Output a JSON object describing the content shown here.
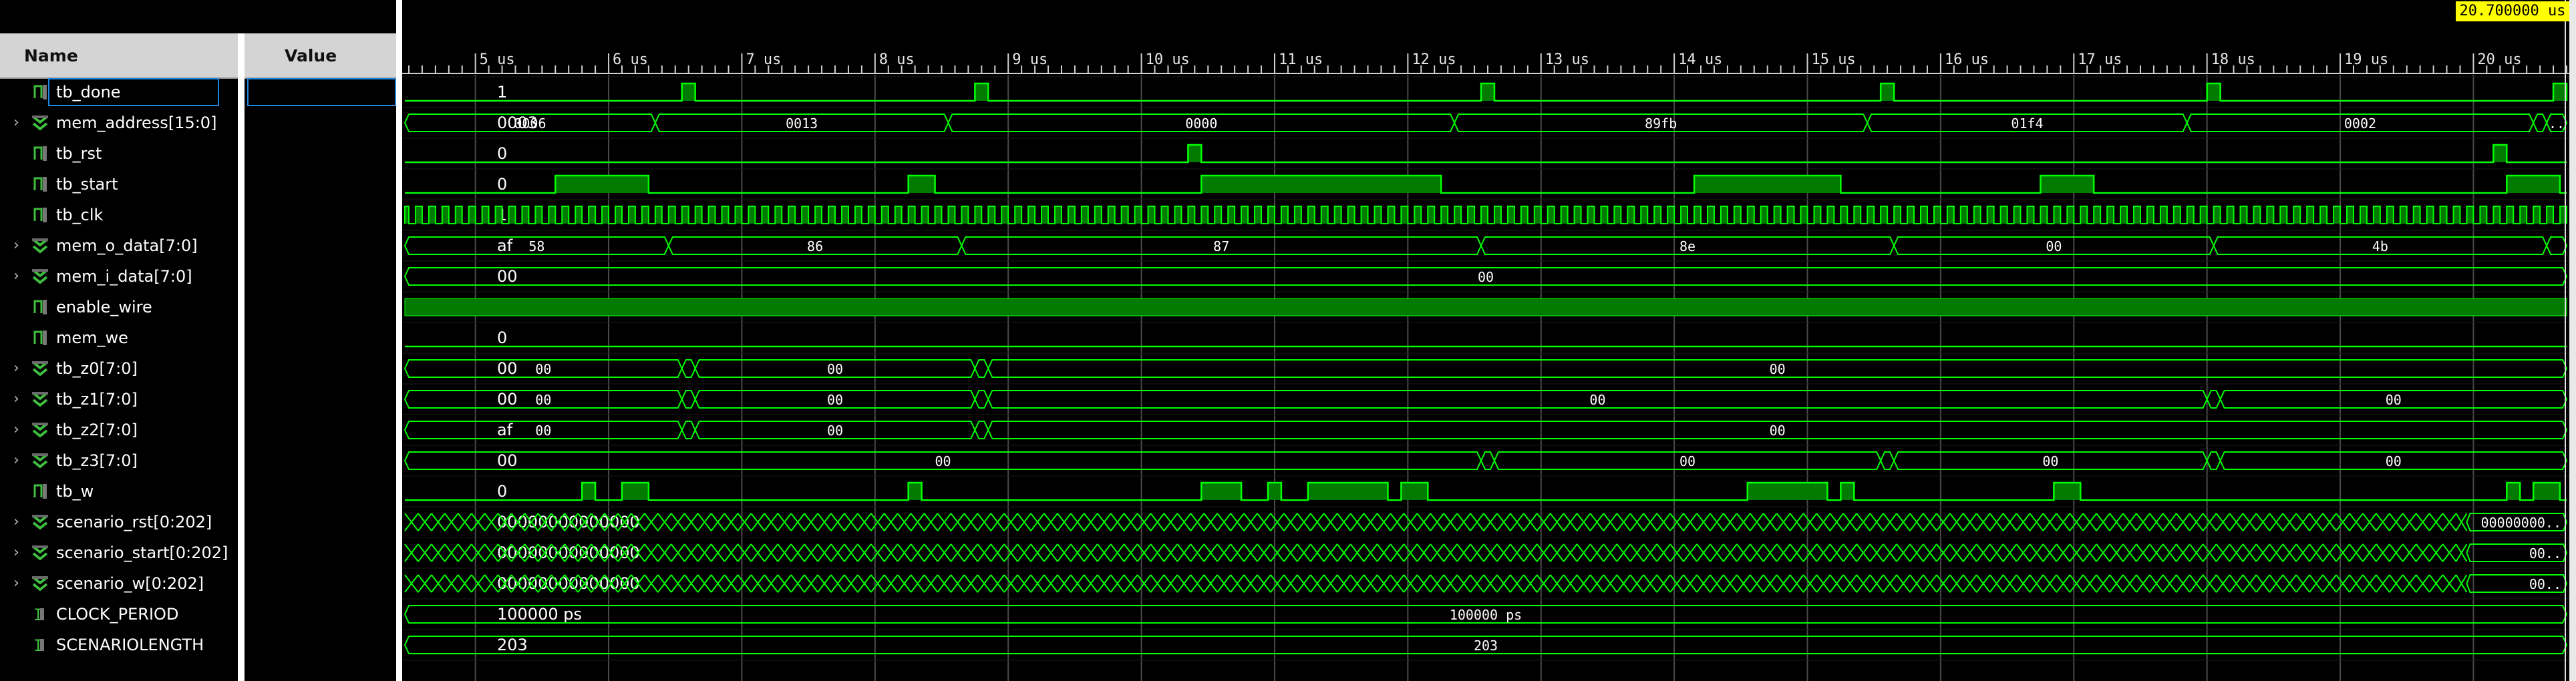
{
  "columns": {
    "name": "Name",
    "value": "Value"
  },
  "cursor": {
    "time": "20.700000 us"
  },
  "colors": {
    "wave": "#00ff00",
    "fill": "#007a00",
    "grid": "#4a4a4a",
    "cursor": "#ffff00"
  },
  "signals": [
    {
      "name": "tb_done",
      "value": "1",
      "kind": "bit",
      "expandable": false
    },
    {
      "name": "mem_address[15:0]",
      "value": "0003",
      "kind": "bus",
      "expandable": true
    },
    {
      "name": "tb_rst",
      "value": "0",
      "kind": "bit",
      "expandable": false
    },
    {
      "name": "tb_start",
      "value": "0",
      "kind": "bit",
      "expandable": false
    },
    {
      "name": "tb_clk",
      "value": "1",
      "kind": "bit",
      "expandable": false
    },
    {
      "name": "mem_o_data[7:0]",
      "value": "af",
      "kind": "bus",
      "expandable": true
    },
    {
      "name": "mem_i_data[7:0]",
      "value": "00",
      "kind": "bus",
      "expandable": true
    },
    {
      "name": "enable_wire",
      "value": "1",
      "kind": "bit",
      "expandable": false
    },
    {
      "name": "mem_we",
      "value": "0",
      "kind": "bit",
      "expandable": false
    },
    {
      "name": "tb_z0[7:0]",
      "value": "00",
      "kind": "bus",
      "expandable": true
    },
    {
      "name": "tb_z1[7:0]",
      "value": "00",
      "kind": "bus",
      "expandable": true
    },
    {
      "name": "tb_z2[7:0]",
      "value": "af",
      "kind": "bus",
      "expandable": true
    },
    {
      "name": "tb_z3[7:0]",
      "value": "00",
      "kind": "bus",
      "expandable": true
    },
    {
      "name": "tb_w",
      "value": "0",
      "kind": "bit",
      "expandable": false
    },
    {
      "name": "scenario_rst[0:202]",
      "value": "0000000000000000",
      "kind": "bus",
      "expandable": true
    },
    {
      "name": "scenario_start[0:202]",
      "value": "0000000000000000",
      "kind": "bus",
      "expandable": true
    },
    {
      "name": "scenario_w[0:202]",
      "value": "0000000000000000",
      "kind": "bus",
      "expandable": true
    },
    {
      "name": "CLOCK_PERIOD",
      "value": "100000 ps",
      "kind": "param",
      "expandable": false
    },
    {
      "name": "SCENARIOLENGTH",
      "value": "203",
      "kind": "param",
      "expandable": false
    }
  ],
  "timeline": {
    "start_us": 4.47,
    "end_us": 20.7,
    "tick_labels": [
      "5 us",
      "6 us",
      "7 us",
      "8 us",
      "9 us",
      "10 us",
      "11 us",
      "12 us",
      "13 us",
      "14 us",
      "15 us",
      "16 us",
      "17 us",
      "18 us",
      "19 us",
      "20 us"
    ],
    "tick_values": [
      5,
      6,
      7,
      8,
      9,
      10,
      11,
      12,
      13,
      14,
      15,
      16,
      17,
      18,
      19,
      20
    ]
  },
  "waves": {
    "tb_done": {
      "type": "bit",
      "init": 0,
      "high": [
        [
          6.55,
          6.65
        ],
        [
          8.75,
          8.85
        ],
        [
          12.55,
          12.65
        ],
        [
          15.55,
          15.65
        ],
        [
          18.0,
          18.1
        ],
        [
          20.6,
          20.7
        ]
      ]
    },
    "mem_address": {
      "type": "bus",
      "segs": [
        [
          4.47,
          6.35,
          "0006"
        ],
        [
          6.35,
          8.55,
          "0013"
        ],
        [
          8.55,
          12.35,
          "0000"
        ],
        [
          12.35,
          15.45,
          "89fb"
        ],
        [
          15.45,
          17.85,
          "01f4"
        ],
        [
          17.85,
          20.45,
          "0002"
        ],
        [
          20.45,
          20.55,
          ""
        ],
        [
          20.55,
          20.7,
          ".."
        ]
      ]
    },
    "tb_rst": {
      "type": "bit",
      "init": 0,
      "high": [
        [
          10.35,
          10.45
        ],
        [
          20.15,
          20.25
        ]
      ]
    },
    "tb_start": {
      "type": "bit",
      "init": 0,
      "high": [
        [
          5.6,
          6.3
        ],
        [
          8.25,
          8.45
        ],
        [
          10.45,
          12.25
        ],
        [
          14.15,
          15.25
        ],
        [
          16.75,
          17.15
        ],
        [
          20.25,
          20.65
        ]
      ]
    },
    "tb_clk": {
      "type": "clock",
      "period": 0.1
    },
    "mem_o_data": {
      "type": "bus",
      "segs": [
        [
          4.47,
          6.45,
          "58"
        ],
        [
          6.45,
          8.65,
          "86"
        ],
        [
          8.65,
          12.55,
          "87"
        ],
        [
          12.55,
          15.65,
          "8e"
        ],
        [
          15.65,
          18.05,
          "00"
        ],
        [
          18.05,
          20.55,
          "4b"
        ],
        [
          20.55,
          20.7,
          ""
        ]
      ]
    },
    "mem_i_data": {
      "type": "bus",
      "segs": [
        [
          4.47,
          20.7,
          "00"
        ]
      ]
    },
    "enable_wire": {
      "type": "solid"
    },
    "mem_we": {
      "type": "bit",
      "init": 0,
      "high": []
    },
    "tb_z0": {
      "type": "bus",
      "segs": [
        [
          4.47,
          6.55,
          "00"
        ],
        [
          6.55,
          6.65,
          ""
        ],
        [
          6.65,
          8.75,
          "00"
        ],
        [
          8.75,
          8.85,
          ""
        ],
        [
          8.85,
          20.7,
          "00"
        ]
      ]
    },
    "tb_z1": {
      "type": "bus",
      "segs": [
        [
          4.47,
          6.55,
          "00"
        ],
        [
          6.55,
          6.65,
          ""
        ],
        [
          6.65,
          8.75,
          "00"
        ],
        [
          8.75,
          8.85,
          ""
        ],
        [
          8.85,
          18.0,
          "00"
        ],
        [
          18.0,
          18.1,
          ""
        ],
        [
          18.1,
          20.7,
          "00"
        ]
      ]
    },
    "tb_z2": {
      "type": "bus",
      "segs": [
        [
          4.47,
          6.55,
          "00"
        ],
        [
          6.55,
          6.65,
          ""
        ],
        [
          6.65,
          8.75,
          "00"
        ],
        [
          8.75,
          8.85,
          ""
        ],
        [
          8.85,
          20.7,
          "00"
        ]
      ]
    },
    "tb_z3": {
      "type": "bus",
      "segs": [
        [
          4.47,
          12.55,
          "00"
        ],
        [
          12.55,
          12.65,
          ""
        ],
        [
          12.65,
          15.55,
          "00"
        ],
        [
          15.55,
          15.65,
          ""
        ],
        [
          15.65,
          18.0,
          "00"
        ],
        [
          18.0,
          18.1,
          ""
        ],
        [
          18.1,
          20.7,
          "00"
        ]
      ]
    },
    "tb_w": {
      "type": "bit",
      "init": 0,
      "high": [
        [
          5.8,
          5.9
        ],
        [
          6.1,
          6.3
        ],
        [
          8.25,
          8.35
        ],
        [
          10.45,
          10.75
        ],
        [
          10.95,
          11.05
        ],
        [
          11.25,
          11.85
        ],
        [
          11.95,
          12.15
        ],
        [
          14.55,
          15.15
        ],
        [
          15.25,
          15.35
        ],
        [
          16.85,
          17.05
        ],
        [
          20.25,
          20.35
        ],
        [
          20.45,
          20.65
        ]
      ]
    },
    "scenario_rst": {
      "type": "dense",
      "last_label": "00000000.."
    },
    "scenario_start": {
      "type": "dense",
      "last_label": "00.."
    },
    "scenario_w": {
      "type": "dense",
      "last_label": "00.."
    },
    "clock_period": {
      "type": "bus",
      "segs": [
        [
          4.47,
          20.7,
          "100000 ps"
        ]
      ]
    },
    "scenariolength": {
      "type": "bus",
      "segs": [
        [
          4.47,
          20.7,
          "203"
        ]
      ]
    }
  }
}
